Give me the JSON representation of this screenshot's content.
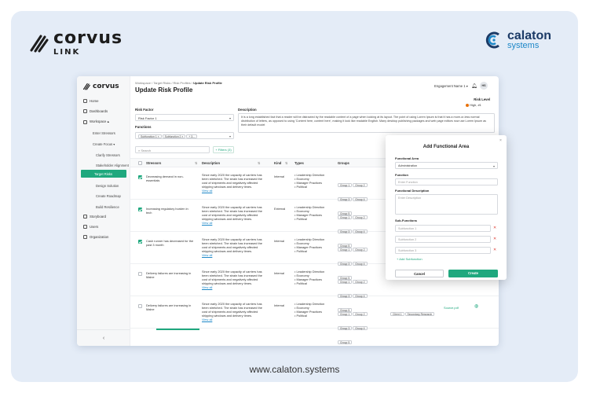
{
  "branding": {
    "left": {
      "name": "corvus",
      "sub": "LINK"
    },
    "right": {
      "name": "calaton",
      "sub": "systems"
    },
    "footer_url": "www.calaton.systems"
  },
  "sidebar": {
    "logo": "corvus",
    "items": [
      {
        "label": "Home",
        "icon": "home-icon"
      },
      {
        "label": "Dashboards",
        "icon": "chart-icon"
      },
      {
        "label": "Workspace  ▴",
        "icon": "workspace-icon"
      }
    ],
    "workspace_sub": [
      "Enter Stressors",
      "Create Focus  ▾",
      "Clarify Stressors",
      "Stakeholder Alignment",
      "Target Risks",
      "Design Solution",
      "Create Roadmap",
      "Build Resilience"
    ],
    "active": "Target Risks",
    "bottom_items": [
      {
        "label": "Storyboard",
        "icon": "storyboard-icon"
      },
      {
        "label": "Users",
        "icon": "users-icon"
      },
      {
        "label": "Organization",
        "icon": "org-icon"
      }
    ],
    "collapse": "‹"
  },
  "header": {
    "breadcrumb_prefix": "Workspace / Target Risks / Risk Profiles / ",
    "breadcrumb_current": "Update Risk Profile",
    "title": "Update Risk Profile",
    "engagement": "Engagement Name 1  ▾",
    "avatar": "HS"
  },
  "risk_level": {
    "label": "Risk Level",
    "value": "High, #1",
    "color": "#e8710a"
  },
  "form": {
    "risk_factor_label": "Risk Factor",
    "risk_factor_value": "Risk Factor 1",
    "description_label": "Description",
    "description_text": "It is a long established fact that a reader will be distracted by the readable content of a page when looking at its layout. The point of using Lorem Ipsum is that it has a more-or-less normal distribution of letters, as opposed to using 'Content here, content here', making it look like readable English. Many desktop publishing packages and web page editors now use Lorem Ipsum as their default model",
    "functions_label": "Functions",
    "functions_chips": [
      "Subfunction 1  ×",
      "Subfunction 2  ×",
      "+ 3..."
    ]
  },
  "search": {
    "placeholder": "Search",
    "filter_label": "+ Filters (3)"
  },
  "table": {
    "headers": [
      "Stressors",
      "Description",
      "Kind",
      "Types",
      "Groups"
    ],
    "rows": [
      {
        "checked": true,
        "stressor": "Decreasing demand in non-essentials",
        "desc": "Since early 2020 the capacity of carriers has been stretched. The strain has increased the cost of shipments and negatively affected shipping windows and delivery times.",
        "link": "View all",
        "kind": "Internal",
        "types": [
          "Leadership Direction",
          "Economy",
          "Manager Practices",
          "Political"
        ],
        "groups": [
          "Group 1",
          "Group 2",
          "Group 3",
          "Group 4",
          "Group 5"
        ]
      },
      {
        "checked": true,
        "stressor": "Increasing regulatory burden in tech",
        "desc": "Since early 2020 the capacity of carriers has been stretched. The strain has increased the cost of shipments and negatively affected shipping windows and delivery times.",
        "link": "View all",
        "kind": "External",
        "types": [
          "Leadership Direction",
          "Economy",
          "Manager Practices",
          "Political"
        ],
        "groups": [
          "Group 1",
          "Group 2",
          "Group 3",
          "Group 4",
          "Group 5"
        ]
      },
      {
        "checked": true,
        "stressor": "Cash runner has decreased for the past 3 month",
        "desc": "Since early 2020 the capacity of carriers has been stretched. The strain has increased the cost of shipments and negatively affected shipping windows and delivery times.",
        "link": "View all",
        "kind": "Internal",
        "types": [
          "Leadership Direction",
          "Economy",
          "Manager Practices",
          "Political"
        ],
        "groups": [
          "Group 1",
          "Group 2",
          "Group 3",
          "Group 4",
          "Group 5"
        ]
      },
      {
        "checked": false,
        "stressor": "Delivery failures are increasing in Maine",
        "desc": "Since early 2020 the capacity of carriers has been stretched. The strain has increased the cost of shipments and negatively affected shipping windows and delivery times.",
        "link": "View all",
        "kind": "Internal",
        "types": [
          "Leadership Direction",
          "Economy",
          "Manager Practices",
          "Political"
        ],
        "groups": [
          "Group 1",
          "Group 2",
          "Group 3",
          "Group 4",
          "Group 5"
        ]
      },
      {
        "checked": false,
        "stressor": "Delivery failures are increasing in Maine",
        "desc": "Since early 2020 the capacity of carriers has been stretched. The strain has increased the cost of shipments and negatively affected shipping windows and delivery times.",
        "link": "View all",
        "kind": "Internal",
        "types": [
          "Leadership Direction",
          "Economy",
          "Manager Practices",
          "Political"
        ],
        "groups": [
          "Group 1",
          "Group 2",
          "Group 3",
          "Group 4",
          "Group 5"
        ],
        "extra_chips": [
          "Client 1",
          "Secondary Research"
        ],
        "extra_link": "Source.pdf"
      }
    ]
  },
  "modal": {
    "title": "Add Functional Area",
    "functional_area_label": "Functional Area",
    "functional_area_value": "Administration",
    "function_label": "Function",
    "function_placeholder": "Enter Function",
    "function_desc_label": "Functional Description",
    "function_desc_placeholder": "Enter Description",
    "subfunctions_label": "Sub-Functions",
    "subfunctions": [
      "Subfunction 1",
      "Subfunction 2",
      "Subfunction 3"
    ],
    "add_sub": "+ Add Subfunction",
    "cancel": "Cancel",
    "create": "Create"
  }
}
